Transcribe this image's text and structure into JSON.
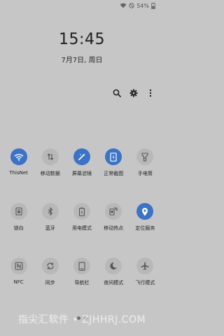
{
  "status_bar": {
    "battery_text": "54%"
  },
  "clock": {
    "time": "15:45",
    "date": "7月7日, 周日"
  },
  "top_actions": {
    "icons": [
      "search-icon",
      "gear-icon",
      "more-vert-icon"
    ]
  },
  "tiles": {
    "row1": [
      {
        "label": "ThisNet",
        "icon": "wifi-icon",
        "on": true
      },
      {
        "label": "移动数据",
        "icon": "mobile-data-icon",
        "on": false
      },
      {
        "label": "屏幕滤镜",
        "icon": "blue-light-filter-icon",
        "on": true
      },
      {
        "label": "正常截图",
        "icon": "screenshot-icon",
        "on": true
      },
      {
        "label": "手电筒",
        "icon": "flashlight-icon",
        "on": false
      }
    ],
    "row2": [
      {
        "label": "锁向",
        "icon": "rotation-lock-icon",
        "on": false
      },
      {
        "label": "蓝牙",
        "icon": "bluetooth-icon",
        "on": false
      },
      {
        "label": "用电模式",
        "icon": "power-mode-icon",
        "on": false
      },
      {
        "label": "移动热点",
        "icon": "hotspot-icon",
        "on": false
      },
      {
        "label": "定位服务",
        "icon": "location-icon",
        "on": true
      }
    ],
    "row3": [
      {
        "label": "NFC",
        "icon": "nfc-icon",
        "on": false
      },
      {
        "label": "同步",
        "icon": "sync-icon",
        "on": false
      },
      {
        "label": "导航栏",
        "icon": "navigation-bar-icon",
        "on": false
      },
      {
        "label": "夜间模式",
        "icon": "night-mode-icon",
        "on": false
      },
      {
        "label": "飞行模式",
        "icon": "airplane-icon",
        "on": false
      }
    ]
  },
  "colors": {
    "background": "#c6c6c6",
    "tile_on": "#3b73c6",
    "tile_off": "#b8b8b8"
  },
  "pager": {
    "pages": 2,
    "active": 1
  },
  "watermark": "指尖汇软件 • ZJHHRJ.COM"
}
